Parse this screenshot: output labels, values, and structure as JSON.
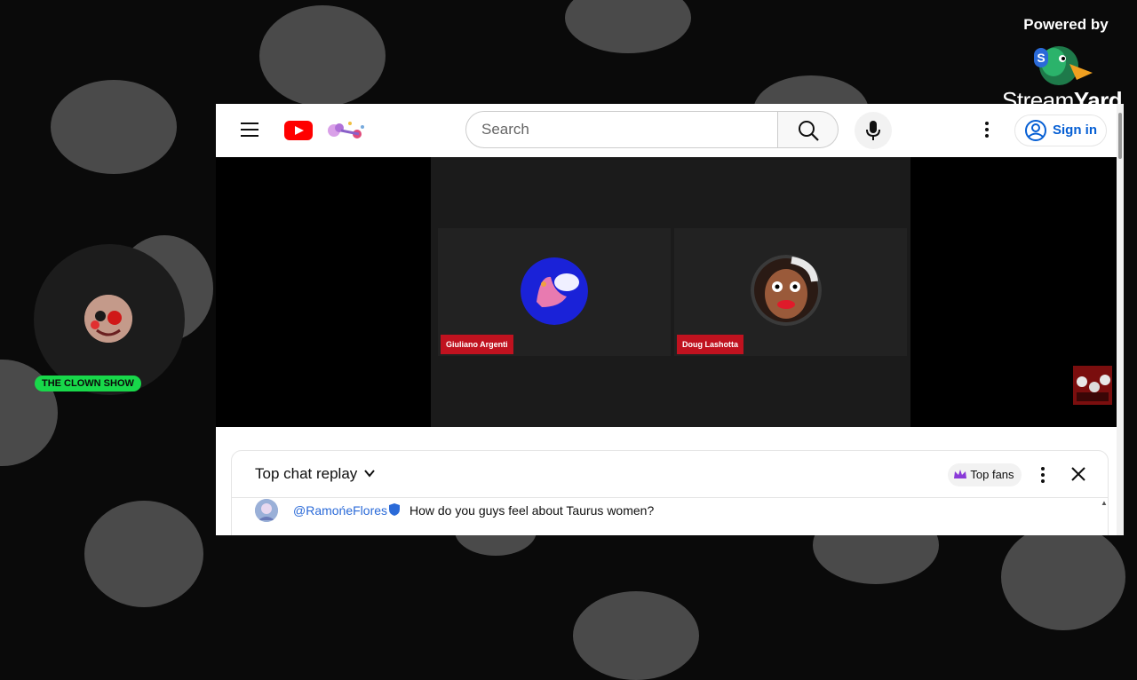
{
  "overlay": {
    "powered_by": "Powered by",
    "brand_prefix": "Stream",
    "brand_suffix": "Yard",
    "host_badge": "THE CLOWN SHOW"
  },
  "youtube": {
    "search": {
      "placeholder": "Search"
    },
    "signin_label": "Sign in",
    "participants": [
      {
        "name": "Giuliano Argenti"
      },
      {
        "name": "Doug Lashotta"
      }
    ]
  },
  "chat": {
    "title": "Top chat replay",
    "top_fans_label": "Top fans",
    "messages": [
      {
        "author": "@RamońeFlores",
        "text": "How do you guys feel about Taurus women?"
      }
    ]
  },
  "colors": {
    "yt_red": "#ff0000",
    "link_blue": "#065fd4",
    "badge_green": "#18d84a",
    "name_tag_red": "#c0121f"
  }
}
